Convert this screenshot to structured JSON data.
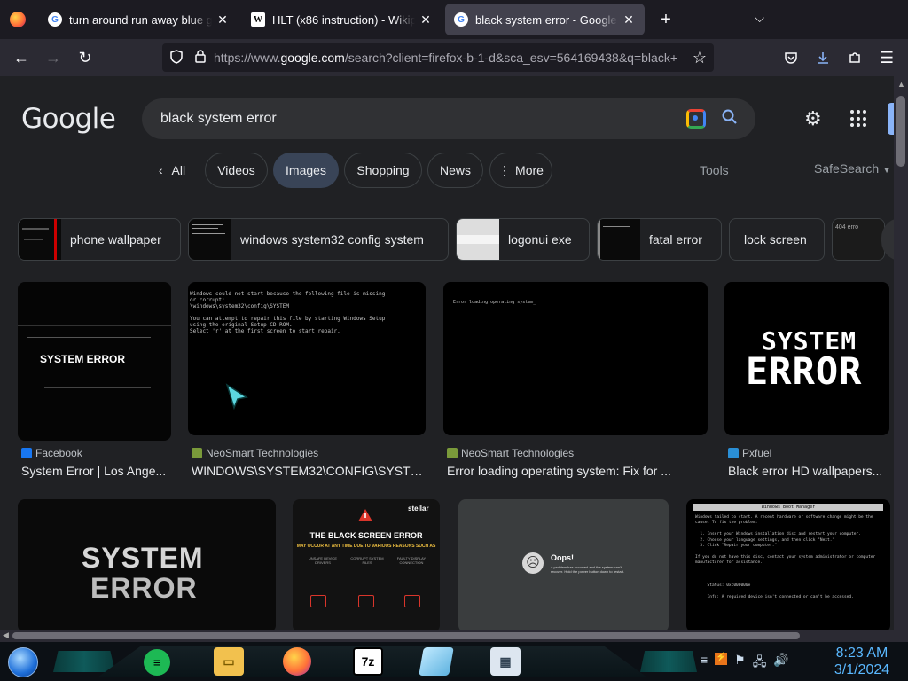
{
  "browser": {
    "tabs": [
      {
        "title": "turn around run away blue gho",
        "favicon": "google-icon"
      },
      {
        "title": "HLT (x86 instruction) - Wikiped",
        "favicon": "wikipedia-icon"
      },
      {
        "title": "black system error - Google Sea",
        "favicon": "google-icon",
        "active": true
      }
    ],
    "url_prefix": "https://www.",
    "url_domain": "google.com",
    "url_rest": "/search?client=firefox-b-1-d&sca_esv=564169438&q=black+"
  },
  "google": {
    "logo": "Google",
    "query": "black system error",
    "filters": [
      {
        "label": "All",
        "kind": "back"
      },
      {
        "label": "Videos"
      },
      {
        "label": "Images",
        "selected": true
      },
      {
        "label": "Shopping"
      },
      {
        "label": "News"
      },
      {
        "label": "More",
        "kind": "more"
      }
    ],
    "tools": "Tools",
    "safesearch": "SafeSearch",
    "related": [
      {
        "label": "phone wallpaper"
      },
      {
        "label": "windows system32 config system"
      },
      {
        "label": "logonui exe"
      },
      {
        "label": "fatal error"
      },
      {
        "label": "lock screen"
      },
      {
        "label": "404 erro"
      }
    ],
    "results": [
      {
        "source": "Facebook",
        "title": "System Error | Los Ange...",
        "image_text": "SYSTEM ERROR"
      },
      {
        "source": "NeoSmart Technologies",
        "title": "WINDOWS\\SYSTEM32\\CONFIG\\SYSTE...",
        "image_text": "Windows could not start because the following file is missing\nor corrupt:\n\\windows\\system32\\config\\SYSTEM\n\nYou can attempt to repair this file by starting Windows Setup\nusing the original Setup CD-ROM.\nSelect 'r' at the first screen to start repair."
      },
      {
        "source": "NeoSmart Technologies",
        "title": "Error loading operating system: Fix for ...",
        "image_text": "Error loading operating system_"
      },
      {
        "source": "Pxfuel",
        "title": "Black error HD wallpapers...",
        "image_line1": "SYSTEM",
        "image_line2": "ERROR"
      },
      {
        "image_line1": "SYSTEM",
        "image_line2": "ERROR"
      },
      {
        "brand": "stellar",
        "heading": "THE BLACK SCREEN ERROR",
        "subheading": "MAY OCCUR AT ANY TIME DUE TO VARIOUS REASONS SUCH AS",
        "reasons": [
          "UNSAFE DEVICE DRIVERS",
          "CORRUPT SYSTEM FILES",
          "FAULTY DISPLAY CONNECTION"
        ]
      },
      {
        "heading": "Oops!",
        "body": "A problem has occurred and the system can't recover. Hold the power button down to restart."
      },
      {
        "header": "Windows Boot Manager",
        "body": "Windows failed to start. A recent hardware or software change might be the\ncause. To fix the problem:\n\n  1. Insert your Windows installation disc and restart your computer.\n  2. Choose your language settings, and then click \"Next.\"\n  3. Click \"Repair your computer.\"\n\nIf you do not have this disc, contact your system administrator or computer\nmanufacturer for assistance.\n\n\n\n     Status: 0xc000000e\n\n     Info: A required device isn't connected or can't be accessed."
      }
    ]
  },
  "taskbar": {
    "apps": [
      "spotify-icon",
      "file-explorer-icon",
      "firefox-icon",
      "7zip-icon",
      "notepad-icon",
      "task-manager-icon"
    ],
    "app_7zip_label": "7z",
    "time": "8:23 AM",
    "date": "3/1/2024"
  },
  "colors": {
    "accent": "#8ab4f8",
    "selected_chip": "#394457",
    "page_bg": "#202124"
  }
}
